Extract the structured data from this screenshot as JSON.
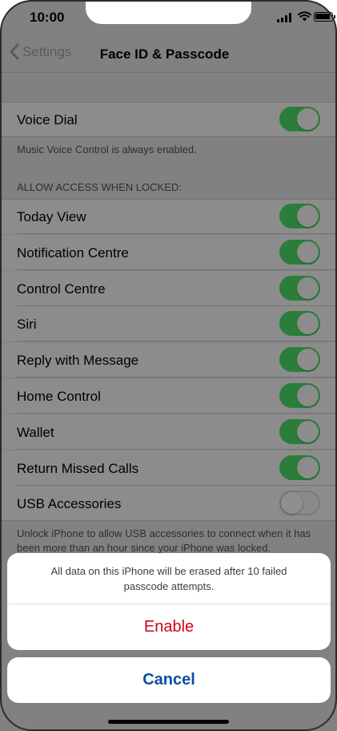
{
  "status": {
    "time": "10:00"
  },
  "nav": {
    "back_label": "Settings",
    "title": "Face ID & Passcode"
  },
  "voice_dial": {
    "label": "Voice Dial",
    "on": true,
    "footnote": "Music Voice Control is always enabled."
  },
  "locked_section": {
    "header": "ALLOW ACCESS WHEN LOCKED:",
    "items": [
      {
        "label": "Today View",
        "on": true
      },
      {
        "label": "Notification Centre",
        "on": true
      },
      {
        "label": "Control Centre",
        "on": true
      },
      {
        "label": "Siri",
        "on": true
      },
      {
        "label": "Reply with Message",
        "on": true
      },
      {
        "label": "Home Control",
        "on": true
      },
      {
        "label": "Wallet",
        "on": true
      },
      {
        "label": "Return Missed Calls",
        "on": true
      },
      {
        "label": "USB Accessories",
        "on": false
      }
    ],
    "footnote": "Unlock iPhone to allow USB accessories to connect when it has been more than an hour since your iPhone was locked."
  },
  "action_sheet": {
    "message": "All data on this iPhone will be erased after 10 failed passcode attempts.",
    "enable_label": "Enable",
    "cancel_label": "Cancel"
  },
  "colors": {
    "toggle_on": "#34C759",
    "destructive": "#FF3B30",
    "action": "#007AFF"
  }
}
